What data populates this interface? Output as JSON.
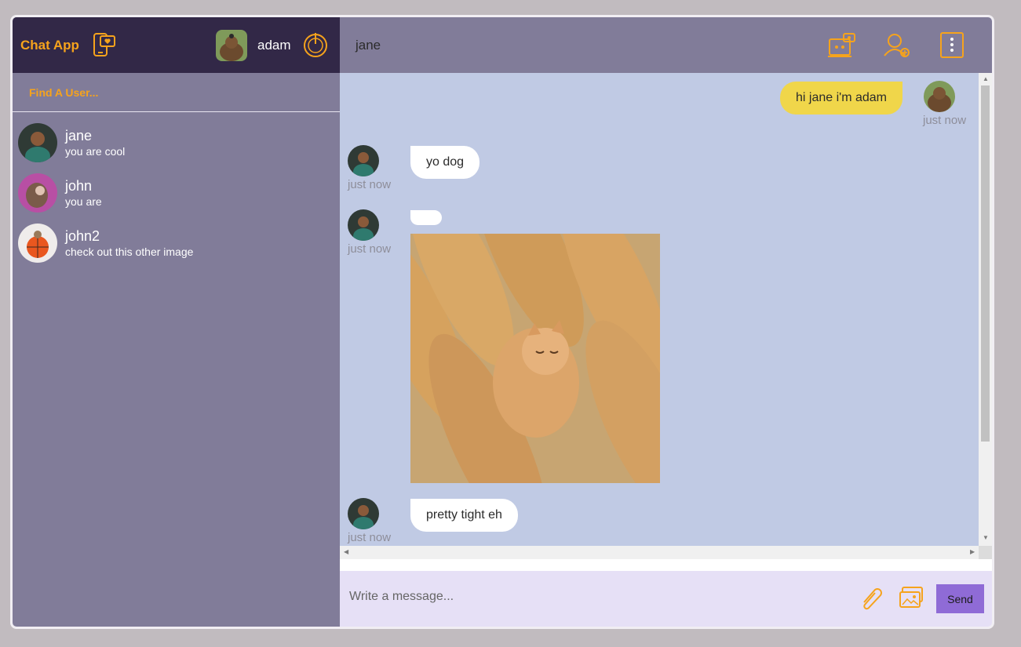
{
  "app": {
    "brand": "Chat App",
    "current_user": "adam"
  },
  "search": {
    "placeholder": "Find A User..."
  },
  "contacts": [
    {
      "name": "jane",
      "last_message": "you are cool"
    },
    {
      "name": "john",
      "last_message": "you are"
    },
    {
      "name": "john2",
      "last_message": "check out this other image"
    }
  ],
  "chat": {
    "title": "jane",
    "messages": [
      {
        "sender": "adam",
        "direction": "out",
        "text": "hi jane i'm adam",
        "time": "just now"
      },
      {
        "sender": "jane",
        "direction": "in",
        "text": "yo dog",
        "time": "just now"
      },
      {
        "sender": "jane",
        "direction": "in",
        "text": "",
        "time": "just now",
        "has_image": true
      },
      {
        "sender": "jane",
        "direction": "in",
        "text": "pretty tight eh",
        "time": "just now"
      }
    ]
  },
  "composer": {
    "placeholder": "Write a message...",
    "send_label": "Send"
  },
  "icons": {
    "brand": "chat-heart-phone-icon",
    "logout": "power-icon",
    "video_call": "video-camera-icon",
    "add_friend": "add-user-icon",
    "more": "more-vertical-icon",
    "attach": "paperclip-icon",
    "image": "image-upload-icon"
  },
  "colors": {
    "accent": "#f6a31c",
    "sidebar_bg": "#817c99",
    "header_dark": "#322847",
    "chat_bg": "#c0cae4",
    "bubble_out": "#f0d64a",
    "send_button": "#8f6bd6"
  }
}
